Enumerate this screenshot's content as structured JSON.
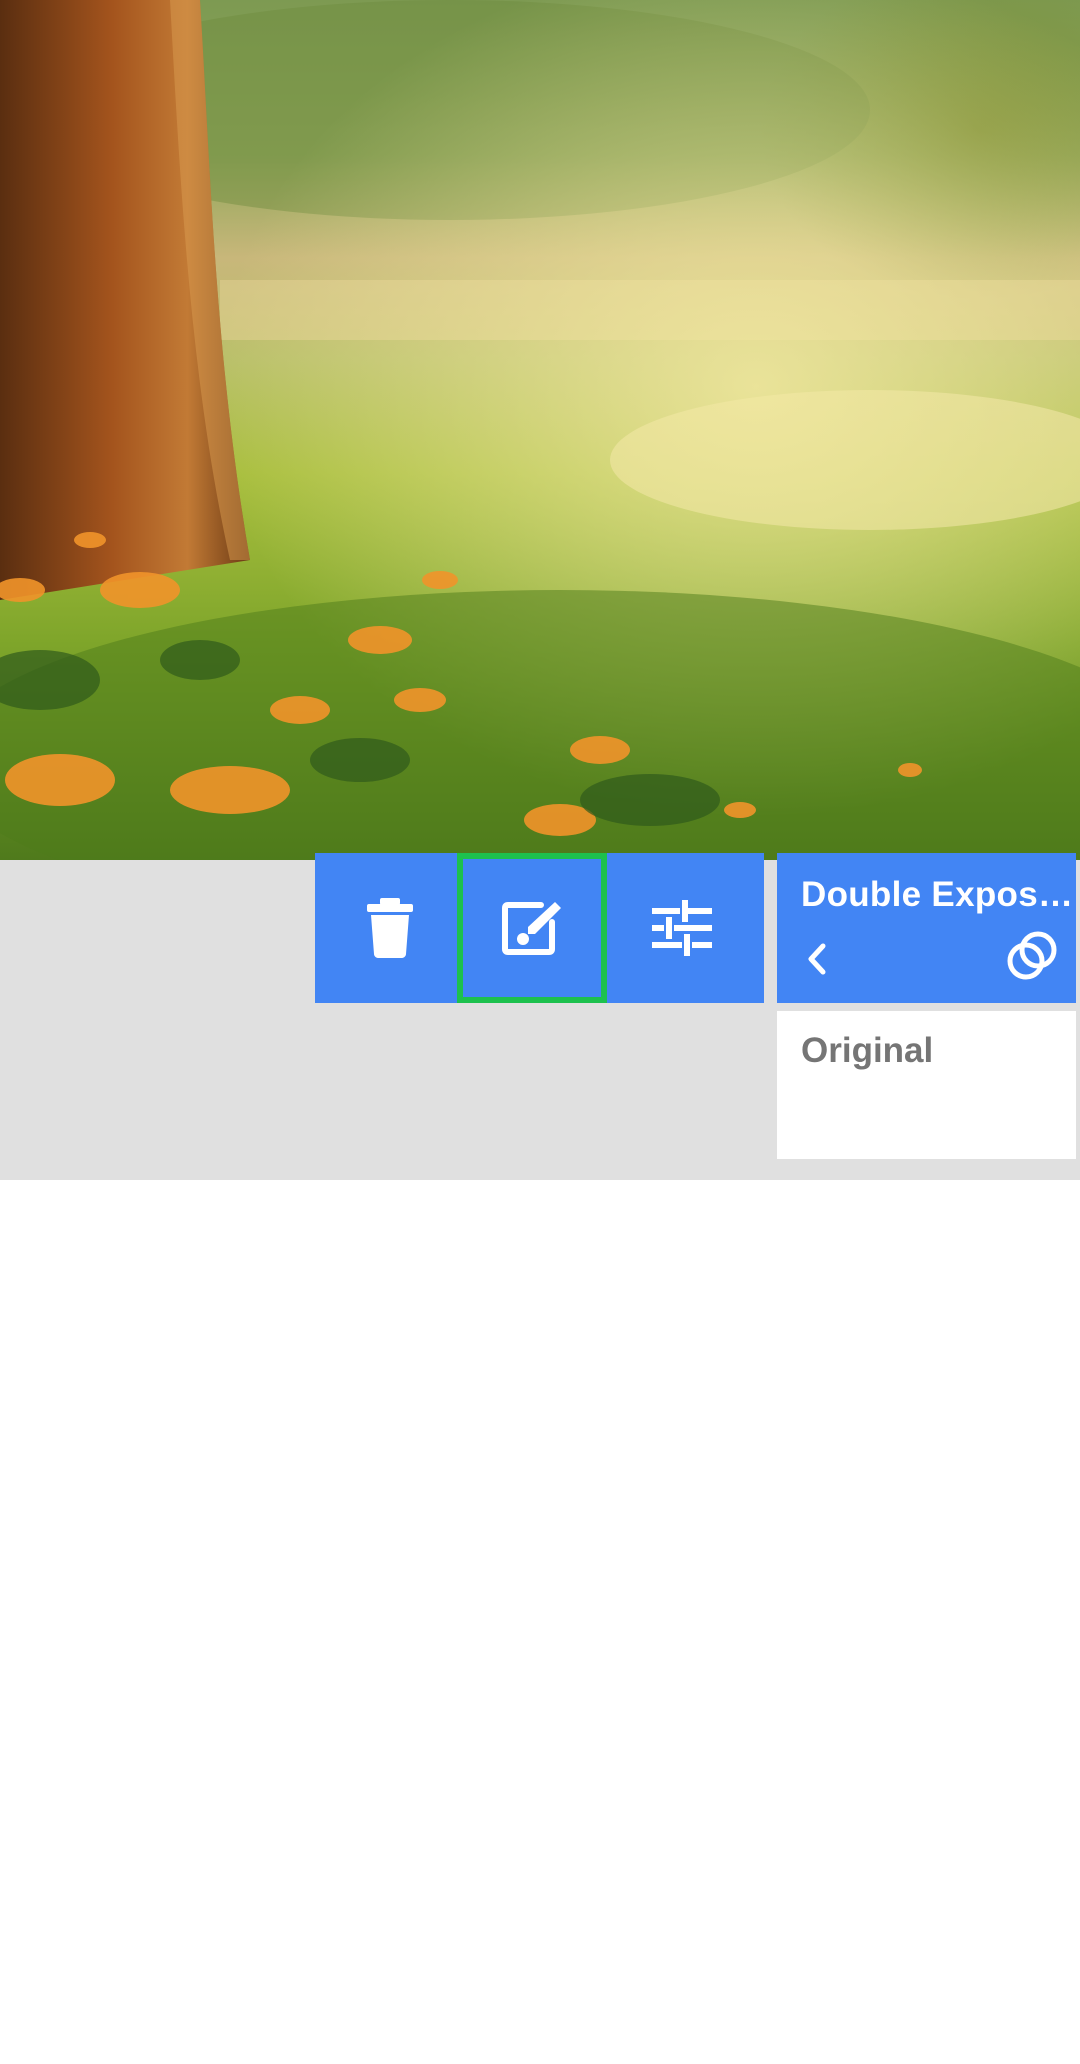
{
  "photo": {
    "description_icon": "landscape-photo"
  },
  "toolbar": {
    "buttons": [
      {
        "name": "delete",
        "icon": "trash-icon"
      },
      {
        "name": "edit",
        "icon": "edit-brush-icon",
        "selected": true
      },
      {
        "name": "adjust",
        "icon": "sliders-icon"
      }
    ],
    "accent_color": "#4285f4",
    "selection_color": "#1dc14e"
  },
  "effect_panel": {
    "title": "Double Exposure",
    "back_icon": "chevron-left-icon",
    "blend_icon": "double-exposure-icon",
    "options": [
      {
        "label": "Original"
      }
    ]
  },
  "colors": {
    "panel_background": "#e0e0e0",
    "option_text": "#757575"
  }
}
